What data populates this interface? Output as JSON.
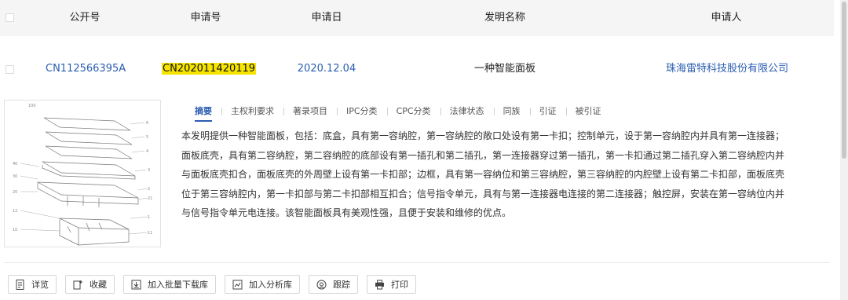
{
  "columns": [
    "公开号",
    "申请号",
    "申请日",
    "发明名称",
    "申请人"
  ],
  "record": {
    "publication_no": "CN112566395A",
    "application_no": "CN202011420119",
    "application_date": "2020.12.04",
    "title": "一种智能面板",
    "applicant": "珠海雷特科技股份有限公司"
  },
  "tabs": [
    "摘要",
    "主权利要求",
    "著录项目",
    "IPC分类",
    "CPC分类",
    "法律状态",
    "同族",
    "引证",
    "被引证"
  ],
  "active_tab": "摘要",
  "abstract_lines": [
    "本发明提供一种智能面板，包括：底盒，具有第一容纳腔，第一容纳腔的敞口处设有第一卡扣；控制单元，设于第一容纳腔内并具有第一连接器；",
    "面板底壳，具有第二容纳腔，第二容纳腔的底部设有第一插孔和第二插孔，第一连接器穿过第一插孔，第一卡扣通过第二插孔穿入第二容纳腔内并",
    "与面板底壳扣合，面板底壳的外周壁上设有第一卡扣部；边框，具有第一容纳位和第三容纳腔，第三容纳腔的内腔壁上设有第二卡扣部，面板底壳",
    "位于第三容纳腔内，第一卡扣部与第二卡扣部相互扣合；信号指令单元，具有与第一连接器电连接的第二连接器；触控屏，安装在第一容纳位内并",
    "与信号指令单元电连接。该智能面板具有美观性强，且便于安装和维修的优点。"
  ],
  "actions": [
    {
      "label": "详览",
      "icon": "detail-icon"
    },
    {
      "label": "收藏",
      "icon": "favorite-icon"
    },
    {
      "label": "加入批量下载库",
      "icon": "download-icon"
    },
    {
      "label": "加入分析库",
      "icon": "analysis-icon"
    },
    {
      "label": "跟踪",
      "icon": "track-icon"
    },
    {
      "label": "打印",
      "icon": "print-icon"
    }
  ],
  "colors": {
    "link": "#2a5db0",
    "highlight": "#f6e400",
    "header_bg": "#f5f5f5"
  }
}
